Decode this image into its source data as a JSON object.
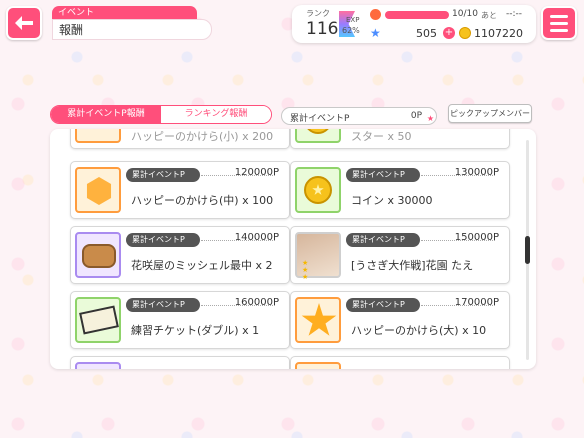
{
  "header": {
    "category": "イベント",
    "title": "報酬"
  },
  "status": {
    "rank_label": "ランク",
    "rank": "116",
    "exp_label": "EXP",
    "exp_percent": "62%",
    "exp_fraction": 0.62,
    "life": "10/10",
    "life_fraction": 1.0,
    "life_after": "あと",
    "life_timer": "--:--",
    "stars": "505",
    "coins": "1107220"
  },
  "tabs": [
    {
      "label": "累計イベントP報酬",
      "active": true
    },
    {
      "label": "ランキング報酬",
      "active": false
    }
  ],
  "points": {
    "label": "累計イベントP",
    "value": "0P"
  },
  "pickup_button": "ピックアップメンバー",
  "rewards": [
    {
      "req_label": "",
      "req_value": "",
      "name": "ハッピーのかけら(小) x 200",
      "thumb": "orange",
      "icon": "star-badge-icon",
      "partial": true
    },
    {
      "req_label": "",
      "req_value": "",
      "name": "スター x 50",
      "thumb": "green",
      "icon": "coin-icon",
      "partial": true
    },
    {
      "req_label": "累計イベントP",
      "req_value": "120000P",
      "name": "ハッピーのかけら(中) x 100",
      "thumb": "orange",
      "icon": "happy-shard-icon",
      "partial": false
    },
    {
      "req_label": "累計イベントP",
      "req_value": "130000P",
      "name": "コイン x 30000",
      "thumb": "green",
      "icon": "coin-icon",
      "partial": false
    },
    {
      "req_label": "累計イベントP",
      "req_value": "140000P",
      "name": "花咲屋のミッシェル最中 x 2",
      "thumb": "purple",
      "icon": "sweet-icon",
      "partial": false
    },
    {
      "req_label": "累計イベントP",
      "req_value": "150000P",
      "name": "[うさぎ大作戦]花園 たえ",
      "thumb": "photo",
      "icon": "member-card-icon",
      "partial": false
    },
    {
      "req_label": "累計イベントP",
      "req_value": "160000P",
      "name": "練習チケット(ダブル) x 1",
      "thumb": "green",
      "icon": "ticket-icon",
      "partial": false
    },
    {
      "req_label": "累計イベントP",
      "req_value": "170000P",
      "name": "ハッピーのかけら(大) x 10",
      "thumb": "orange",
      "icon": "big-star-icon",
      "partial": false
    }
  ]
}
